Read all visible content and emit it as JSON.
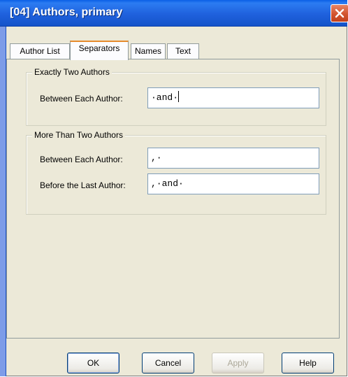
{
  "window": {
    "title": "[04] Authors, primary"
  },
  "tabs": [
    {
      "label": "Author List",
      "active": false
    },
    {
      "label": "Separators",
      "active": true
    },
    {
      "label": "Names",
      "active": false
    },
    {
      "label": "Text",
      "active": false
    }
  ],
  "groups": {
    "two_authors": {
      "legend": "Exactly Two Authors",
      "between_label": "Between Each Author:",
      "between_value": "·and·"
    },
    "more_authors": {
      "legend": "More Than Two Authors",
      "between_label": "Between Each Author:",
      "between_value": ",·",
      "last_label": "Before the Last Author:",
      "last_value": ",·and·"
    }
  },
  "buttons": {
    "ok": "OK",
    "cancel": "Cancel",
    "apply": "Apply",
    "help": "Help"
  },
  "colors": {
    "titlebar": "#1f61dd",
    "dialog_bg": "#ece9d8",
    "close_button": "#d2532e",
    "active_tab_accent": "#e68b2c"
  },
  "icons": {
    "close": "close-icon"
  }
}
